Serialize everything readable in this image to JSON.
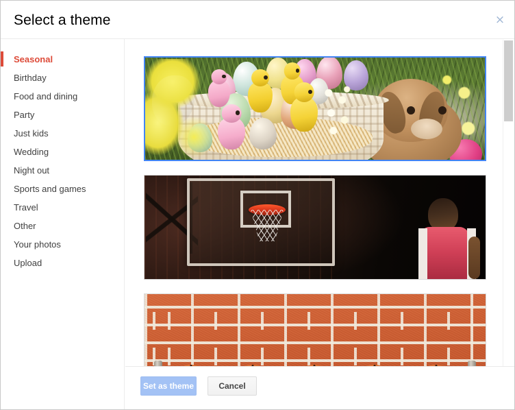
{
  "dialog": {
    "title": "Select a theme",
    "close_icon": "close-icon",
    "close_label": "×"
  },
  "sidebar": {
    "items": [
      {
        "label": "Seasonal",
        "selected": true
      },
      {
        "label": "Birthday",
        "selected": false
      },
      {
        "label": "Food and dining",
        "selected": false
      },
      {
        "label": "Party",
        "selected": false
      },
      {
        "label": "Just kids",
        "selected": false
      },
      {
        "label": "Wedding",
        "selected": false
      },
      {
        "label": "Night out",
        "selected": false
      },
      {
        "label": "Sports and games",
        "selected": false
      },
      {
        "label": "Travel",
        "selected": false
      },
      {
        "label": "Other",
        "selected": false
      },
      {
        "label": "Your photos",
        "selected": false
      },
      {
        "label": "Upload",
        "selected": false
      }
    ]
  },
  "themes": [
    {
      "name": "easter-basket-rabbit-theme",
      "selected": true
    },
    {
      "name": "basketball-hoop-theme",
      "selected": false
    },
    {
      "name": "basketballs-brick-wall-theme",
      "selected": false
    }
  ],
  "footer": {
    "primary_label": "Set as theme",
    "secondary_label": "Cancel"
  },
  "colors": {
    "accent_red": "#dd4b39",
    "selection_blue": "#4285f4",
    "primary_button_disabled": "#a3c2f5",
    "border_gray": "#ebebeb",
    "scrollbar_thumb": "#cdcdcd"
  }
}
